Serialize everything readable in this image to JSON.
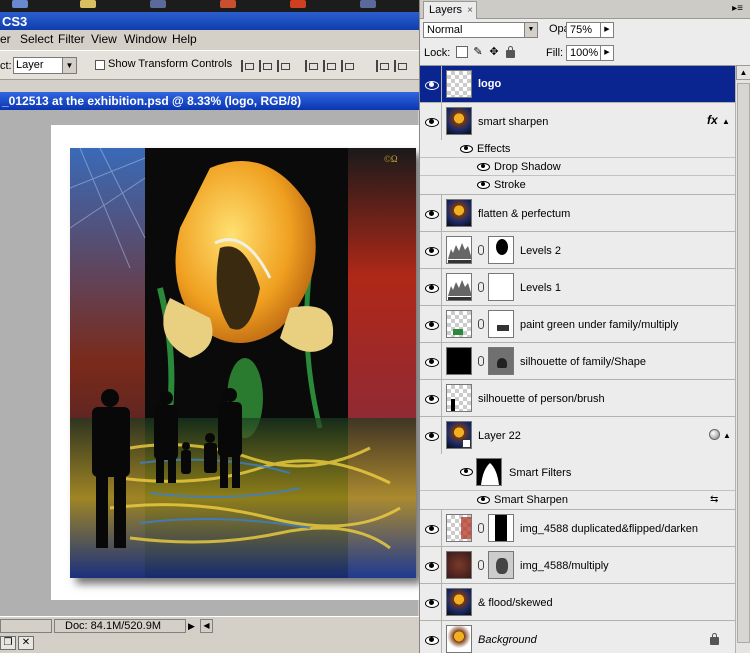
{
  "app": {
    "title": "CS3"
  },
  "menu": [
    "er",
    "Select",
    "Filter",
    "View",
    "Window",
    "Help"
  ],
  "options": {
    "label": "ct:",
    "select_value": "Layer",
    "checkbox_label": "Show Transform Controls"
  },
  "document": {
    "title": "_012513 at the exhibition.psd @ 8.33% (logo, RGB/8)",
    "watermark": "©Ω"
  },
  "status": {
    "doc_info": "Doc: 84.1M/520.9M"
  },
  "layers_panel": {
    "tab_label": "Layers",
    "tab_close": "×",
    "blend_mode": "Normal",
    "opacity_label": "Opacity:",
    "opacity_value": "75%",
    "lock_label": "Lock:",
    "fill_label": "Fill:",
    "fill_value": "100%",
    "fx_label": "fx",
    "layers": [
      {
        "name": "logo"
      },
      {
        "name": "smart sharpen"
      },
      {
        "name": "flatten & perfectum"
      },
      {
        "name": "Levels 2"
      },
      {
        "name": "Levels 1"
      },
      {
        "name": "paint green under family/multiply"
      },
      {
        "name": "silhouette of family/Shape"
      },
      {
        "name": "silhouette of person/brush"
      },
      {
        "name": "Layer 22"
      },
      {
        "name": "img_4588 duplicated&flipped/darken"
      },
      {
        "name": "img_4588/multiply"
      },
      {
        "name": "& flood/skewed"
      },
      {
        "name": "Background"
      }
    ],
    "effects": {
      "label": "Effects",
      "items": [
        "Drop Shadow",
        "Stroke"
      ]
    },
    "smart_filters": {
      "label": "Smart Filters",
      "items": [
        "Smart Sharpen"
      ]
    }
  }
}
